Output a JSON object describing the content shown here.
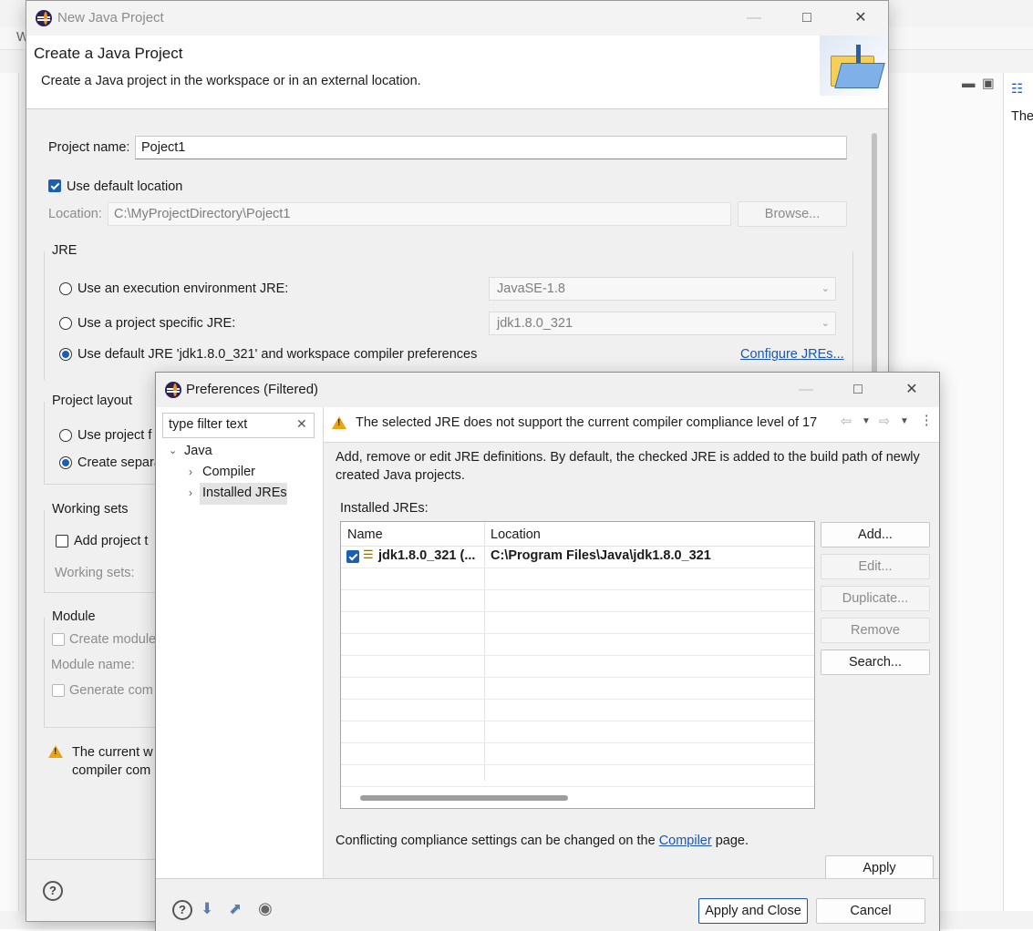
{
  "ide": {
    "right_panel_text": "The",
    "partial_title": "W"
  },
  "new_project": {
    "window_title": "New Java Project",
    "banner_title": "Create a Java Project",
    "banner_subtitle": "Create a Java project in the workspace or in an external location.",
    "project_name_label": "Project name:",
    "project_name_value": "Poject1",
    "use_default_location": "Use default location",
    "location_label": "Location:",
    "location_value": "C:\\MyProjectDirectory\\Poject1",
    "browse_button": "Browse...",
    "jre_group": "JRE",
    "jre_option_env": "Use an execution environment JRE:",
    "jre_env_value": "JavaSE-1.8",
    "jre_option_specific": "Use a project specific JRE:",
    "jre_specific_value": "jdk1.8.0_321",
    "jre_option_default": "Use default JRE 'jdk1.8.0_321' and workspace compiler preferences",
    "configure_jres_link": "Configure JREs...",
    "project_layout_group": "Project layout",
    "layout_option_project": "Use project f",
    "layout_option_separate": "Create separa",
    "working_sets_group": "Working sets",
    "add_project_to": "Add project t",
    "working_sets_label": "Working sets:",
    "module_group": "Module",
    "create_module": "Create module",
    "module_name_label": "Module name:",
    "generate_comments": "Generate com",
    "warning_line1": "The current w",
    "warning_line2": "compiler com"
  },
  "prefs": {
    "window_title": "Preferences (Filtered)",
    "filter_placeholder": "type filter text",
    "tree": {
      "root": "Java",
      "child1": "Compiler",
      "child2": "Installed JREs"
    },
    "warning_message": "The selected JRE does not support the current compiler compliance level of 17",
    "description_line1": "Add, remove or edit JRE definitions. By default, the checked JRE is added to the build path of newly",
    "description_line2": "created Java projects.",
    "installed_jres_label": "Installed JREs:",
    "columns": {
      "name": "Name",
      "location": "Location"
    },
    "jre_row": {
      "name": "jdk1.8.0_321 (...",
      "location": "C:\\Program Files\\Java\\jdk1.8.0_321"
    },
    "buttons": {
      "add": "Add...",
      "edit": "Edit...",
      "duplicate": "Duplicate...",
      "remove": "Remove",
      "search": "Search..."
    },
    "footer_text_before": "Conflicting compliance settings can be changed on the",
    "footer_link": "Compiler",
    "footer_text_after": "page.",
    "apply": "Apply",
    "apply_and_close": "Apply and Close",
    "cancel": "Cancel"
  }
}
